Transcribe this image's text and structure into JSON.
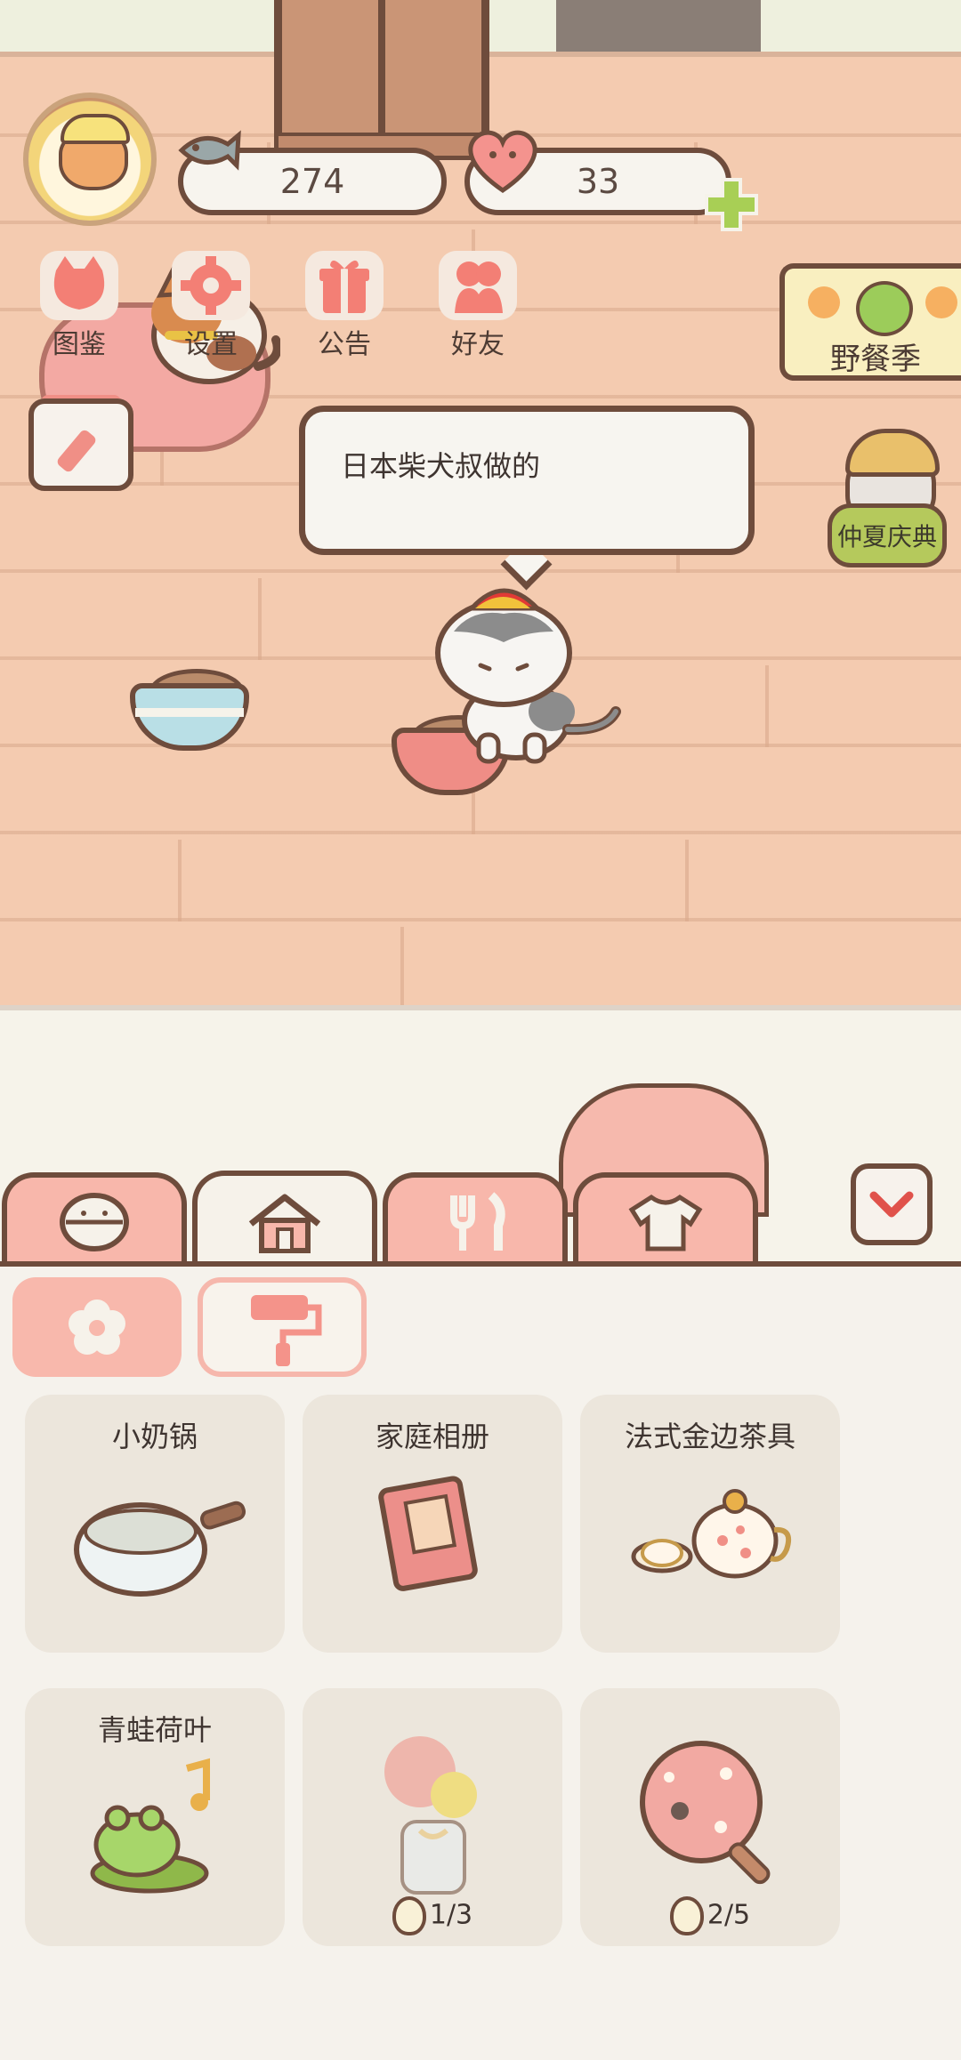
{
  "hud": {
    "fish_count": "274",
    "heart_count": "33"
  },
  "menu": [
    {
      "label": "图鉴",
      "icon": "cat-face-icon"
    },
    {
      "label": "设置",
      "icon": "gear-icon"
    },
    {
      "label": "公告",
      "icon": "gift-icon"
    },
    {
      "label": "好友",
      "icon": "friends-icon"
    }
  ],
  "events": {
    "picnic_label": "野餐季",
    "summer_label": "仲夏庆典"
  },
  "speech": {
    "text": "日本柴犬叔做的"
  },
  "tabs": [
    {
      "icon": "rice-ball-icon",
      "active": false
    },
    {
      "icon": "house-icon",
      "active": true
    },
    {
      "icon": "utensils-icon",
      "active": false
    },
    {
      "icon": "shirt-icon",
      "active": false
    }
  ],
  "subtabs": [
    {
      "icon": "flower-icon",
      "active": true
    },
    {
      "icon": "paint-roller-icon",
      "active": false
    }
  ],
  "items": [
    {
      "name": "小奶锅",
      "count": ""
    },
    {
      "name": "家庭相册",
      "count": ""
    },
    {
      "name": "法式金边茶具",
      "count": ""
    },
    {
      "name": "青蛙荷叶",
      "count": ""
    },
    {
      "name": "",
      "count": "1/3"
    },
    {
      "name": "",
      "count": "2/5"
    }
  ],
  "colors": {
    "outline": "#6e4c3c",
    "wall": "#f4cbb0",
    "accent_pink": "#f8b7ab",
    "panel": "#f5f2ec"
  }
}
